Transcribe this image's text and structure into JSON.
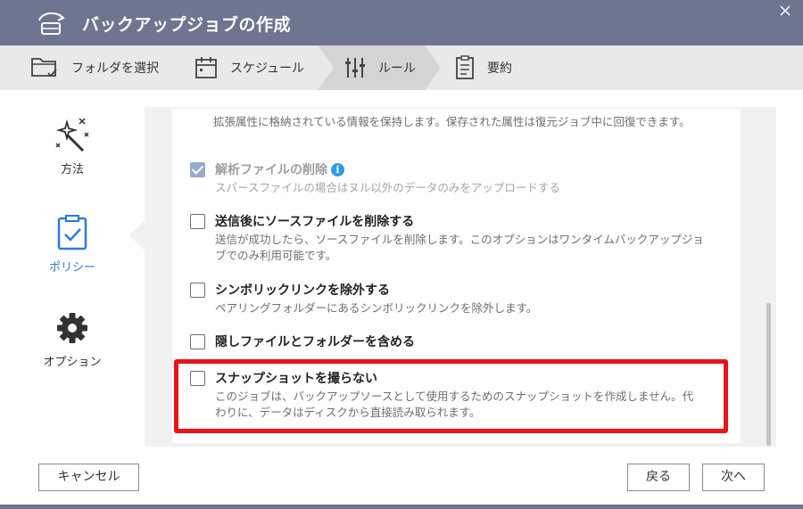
{
  "window": {
    "title": "バックアップジョブの作成"
  },
  "steps": [
    {
      "label": "フォルダを選択",
      "icon": "folder-check-icon"
    },
    {
      "label": "スケジュール",
      "icon": "calendar-icon"
    },
    {
      "label": "ルール",
      "icon": "sliders-icon",
      "active": true
    },
    {
      "label": "要約",
      "icon": "clipboard-list-icon"
    }
  ],
  "nav": {
    "items": [
      {
        "label": "方法",
        "icon": "magic-wand-icon"
      },
      {
        "label": "ポリシー",
        "icon": "clipboard-check-icon",
        "active": true
      },
      {
        "label": "オプション",
        "icon": "gear-icon"
      }
    ]
  },
  "options": {
    "partial_desc": "拡張属性に格納されている情報を保持します。保存された属性は復元ジョブ中に回復できます。",
    "sparse": {
      "title": "解析ファイルの削除",
      "desc": "スパースファイルの場合はヌル以外のデータのみをアップロードする",
      "checked": true,
      "disabled": true
    },
    "delete_source": {
      "title": "送信後にソースファイルを削除する",
      "desc": "送信が成功したら、ソースファイルを削除します。このオプションはワンタイムバックアップジョブでのみ利用可能です。",
      "checked": false
    },
    "exclude_symlinks": {
      "title": "シンボリックリンクを除外する",
      "desc": "ペアリングフォルダーにあるシンボリックリンクを除外します。",
      "checked": false
    },
    "include_hidden": {
      "title": "隠しファイルとフォルダーを含める",
      "checked": false
    },
    "no_snapshot": {
      "title": "スナップショットを撮らない",
      "desc": "このジョブは、バックアップソースとして使用するためのスナップショットを作成しません。代わりに、データはディスクから直接読み取られます。",
      "checked": false
    }
  },
  "footer": {
    "cancel_label": "キャンセル",
    "back_label": "戻る",
    "next_label": "次へ"
  },
  "colors": {
    "header": "#6d7590",
    "steps_bg": "#e9e9e9",
    "active_step": "#d4d4d4",
    "accent": "#2f7ad8",
    "highlight": "#e8141a"
  }
}
